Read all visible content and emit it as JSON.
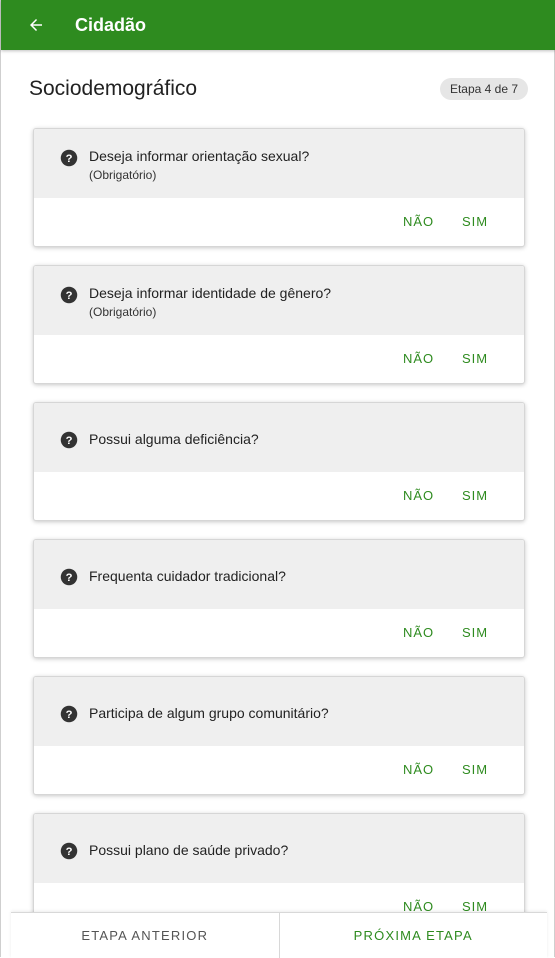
{
  "appbar": {
    "title": "Cidadão"
  },
  "page": {
    "title": "Sociodemográfico",
    "step_badge": "Etapa 4 de 7"
  },
  "questions": [
    {
      "text": "Deseja informar orientação sexual?",
      "sub": "(Obrigatório)",
      "no": "NÃO",
      "yes": "SIM"
    },
    {
      "text": "Deseja informar identidade de gênero?",
      "sub": "(Obrigatório)",
      "no": "NÃO",
      "yes": "SIM"
    },
    {
      "text": "Possui alguma deficiência?",
      "sub": "",
      "no": "NÃO",
      "yes": "SIM"
    },
    {
      "text": "Frequenta cuidador tradicional?",
      "sub": "",
      "no": "NÃO",
      "yes": "SIM"
    },
    {
      "text": "Participa de algum grupo comunitário?",
      "sub": "",
      "no": "NÃO",
      "yes": "SIM"
    },
    {
      "text": "Possui plano de saúde privado?",
      "sub": "",
      "no": "NÃO",
      "yes": "SIM"
    }
  ],
  "footer": {
    "prev": "ETAPA ANTERIOR",
    "next": "PRÓXIMA ETAPA"
  },
  "colors": {
    "primary": "#2e8b1f",
    "card_header": "#efefef",
    "badge_bg": "#e6e6e6"
  },
  "icons": {
    "back": "arrow-left-icon",
    "help": "help-circle-icon"
  }
}
